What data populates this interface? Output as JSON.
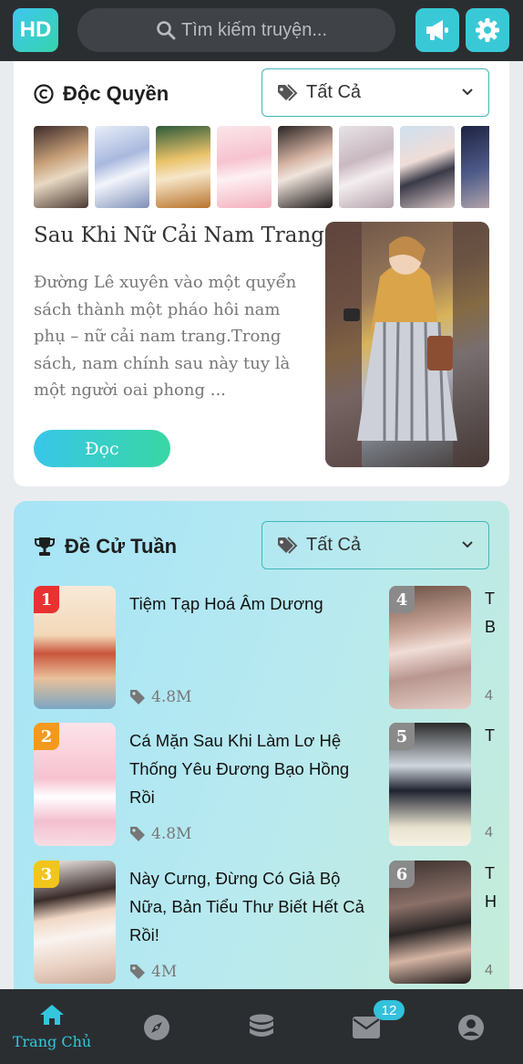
{
  "header": {
    "logo_text": "HD",
    "search_placeholder": "Tìm kiếm truyện...",
    "icons": [
      "search-icon",
      "megaphone-icon",
      "gear-icon"
    ],
    "accent_color": "#39c9d6"
  },
  "exclusive": {
    "title": "Độc Quyền",
    "filter_label": "Tất Cả",
    "featured": {
      "title": "Sau Khi Nữ Cải Nam Trang",
      "description": "Đường Lê xuyên vào một quyển sách thành một pháo hôi nam phụ – nữ cải nam trang.Trong sách, nam chính sau này tuy là một người oai phong ...",
      "read_label": "Đọc"
    }
  },
  "weekly": {
    "title": "Đề Cử Tuần",
    "filter_label": "Tất Cả",
    "items": [
      {
        "rank": "1",
        "title": "Tiệm Tạp Hoá Âm Dương",
        "views": "4.8M",
        "badge_color": "#e8322f"
      },
      {
        "rank": "2",
        "title": "Cá Mặn Sau Khi Làm Lơ Hệ Thống Yêu Đương Bạo Hồng Rồi",
        "views": "4.8M",
        "badge_color": "#f39a1e"
      },
      {
        "rank": "3",
        "title": "Này Cưng, Đừng Có Giả Bộ Nữa, Bản Tiểu Thư Biết Hết Cả Rồi!",
        "views": "4M",
        "badge_color": "#f2c51c"
      },
      {
        "rank": "4",
        "title": "T",
        "title2": "B",
        "views": "4",
        "badge_color": "#8a8a8a"
      },
      {
        "rank": "5",
        "title": "T",
        "views": "4",
        "badge_color": "#8a8a8a"
      },
      {
        "rank": "6",
        "title": "T",
        "title2": "H",
        "views": "4",
        "badge_color": "#8a8a8a"
      }
    ]
  },
  "bottom_nav": {
    "items": [
      {
        "label": "Trang Chủ",
        "icon": "home-icon"
      },
      {
        "label": "",
        "icon": "compass-icon"
      },
      {
        "label": "",
        "icon": "database-icon"
      },
      {
        "label": "",
        "icon": "mail-icon"
      },
      {
        "label": "",
        "icon": "user-icon"
      }
    ],
    "mail_badge": "12"
  }
}
